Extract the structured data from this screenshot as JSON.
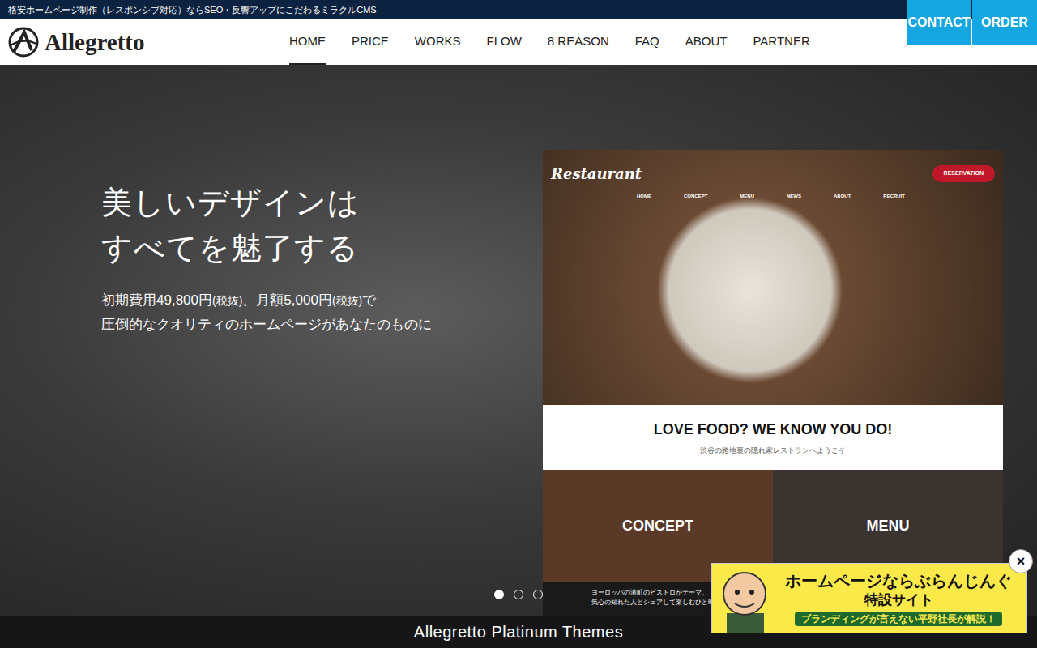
{
  "topbar": {
    "text": "格安ホームページ制作（レスポンシブ対応）ならSEO・反響アップにこだわるミラクルCMS"
  },
  "header": {
    "logo": "Allegretto",
    "nav": [
      {
        "label": "HOME",
        "selected": true
      },
      {
        "label": "PRICE",
        "selected": false
      },
      {
        "label": "WORKS",
        "selected": false
      },
      {
        "label": "FLOW",
        "selected": false
      },
      {
        "label": "8 REASON",
        "selected": false
      },
      {
        "label": "FAQ",
        "selected": false
      },
      {
        "label": "ABOUT",
        "selected": false
      },
      {
        "label": "PARTNER",
        "selected": false
      }
    ],
    "buttons": [
      "CONTACT",
      "ORDER"
    ]
  },
  "hero": {
    "heading": [
      "美しいデザインは",
      "すべてを魅了する"
    ],
    "sub": [
      [
        {
          "text": "初期費用49,800円",
          "small": false
        },
        {
          "text": "(税抜)",
          "small": true
        },
        {
          "text": "、月額5,000円",
          "small": false
        },
        {
          "text": "(税抜)",
          "small": true
        },
        {
          "text": "で",
          "small": false
        }
      ],
      [
        {
          "text": "圧倒的なクオリティのホームページがあなたのものに",
          "small": false
        }
      ]
    ]
  },
  "mockup": {
    "logo": "Restaurant",
    "button": "RESERVATION",
    "nav": [
      "HOME",
      "CONCEPT",
      "MENU",
      "NEWS",
      "ABOUT",
      "RECRUIT"
    ],
    "tagline": "LOVE FOOD? WE KNOW YOU DO!",
    "subtagline": "渋谷の路地裏の隠れ家レストランへようこそ",
    "tiles": [
      "CONCEPT",
      "MENU"
    ],
    "footer_lines": [
      "ヨーロッパの港町のビストロがテーマ。",
      "気心の知れた人とシェアして楽しむひと時"
    ]
  },
  "slider": {
    "dots": [
      {
        "selected": true
      },
      {
        "selected": false
      },
      {
        "selected": false
      }
    ]
  },
  "bottom": {
    "title": "Allegretto Platinum Themes"
  },
  "banner": {
    "title": "ホームページならぶらんじんぐ",
    "subtitle": "特設サイト",
    "note": "ブランディングが言えない平野社長が解説！",
    "close": "×"
  }
}
